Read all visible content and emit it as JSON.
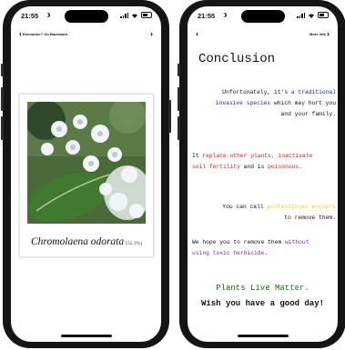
{
  "status_bar": {
    "time": "21:55"
  },
  "left_screen": {
    "back_label": "Encounter? Go Backward.",
    "species_name": "Chromolaena odorata",
    "confidence": "[55.3%]"
  },
  "right_screen": {
    "more_info_label": "More Info",
    "title": "Conclusion",
    "paragraphs": {
      "p1": {
        "a": "Unfortunately, it's ",
        "b": "a traditional invasive species",
        "c": " which may hurt you and your family."
      },
      "p2": {
        "a": "It ",
        "b": "replace other plants, inactivate soil fertility",
        "c": " and is ",
        "d": "poisonous",
        "e": "."
      },
      "p3": {
        "a": "You can call ",
        "b": "professional workers",
        "c": " to remove them."
      },
      "p4": {
        "a": "We hope you to remove them ",
        "b": "without using toxic herbicide",
        "c": "."
      }
    },
    "slogan": "Plants Live Matter.",
    "farewell": "Wish you have a good day!"
  },
  "colors": {
    "blue": "#1a1adb",
    "red": "#e01818",
    "yellow": "#ecd21a",
    "purple": "#8b1fb0",
    "green": "#137317"
  },
  "icons": [
    "chevron-left-icon",
    "chevron-right-icon",
    "signal-icon",
    "wifi-icon",
    "battery-icon",
    "moon-icon"
  ]
}
